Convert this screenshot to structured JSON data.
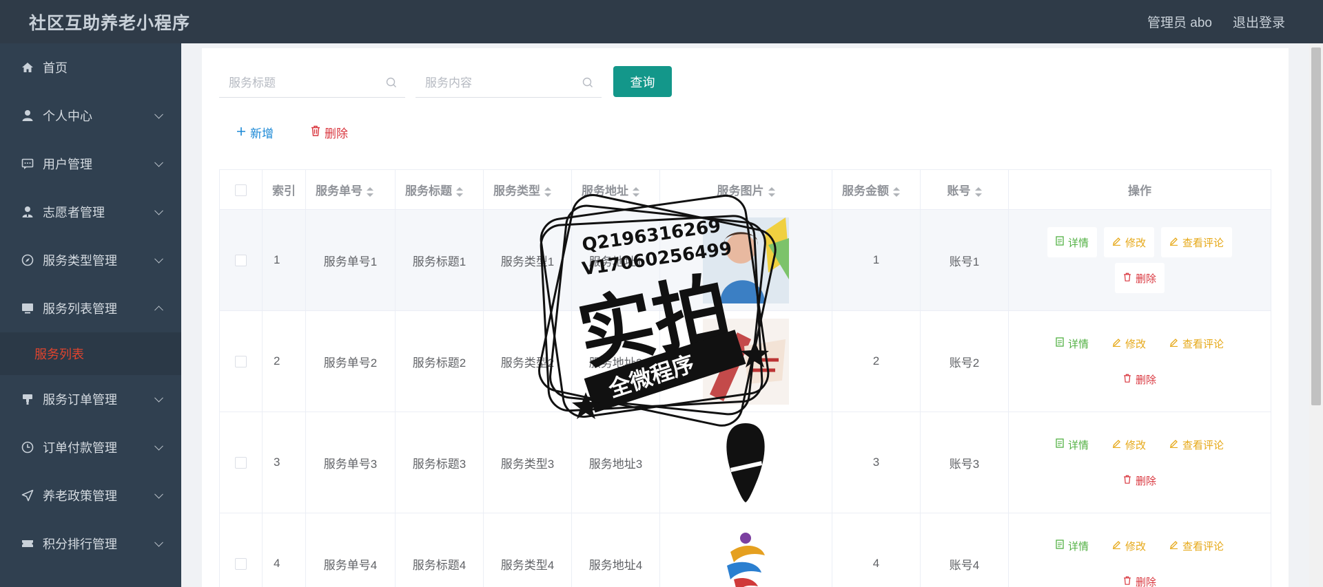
{
  "header": {
    "app_title": "社区互助养老小程序",
    "admin_label": "管理员 abo",
    "logout_label": "退出登录"
  },
  "sidebar": {
    "items": [
      {
        "label": "首页",
        "icon": "home-icon",
        "has_chevron": false
      },
      {
        "label": "个人中心",
        "icon": "user-icon",
        "has_chevron": true
      },
      {
        "label": "用户管理",
        "icon": "chat-icon",
        "has_chevron": true
      },
      {
        "label": "志愿者管理",
        "icon": "volunteer-icon",
        "has_chevron": true
      },
      {
        "label": "服务类型管理",
        "icon": "compass-icon",
        "has_chevron": true
      },
      {
        "label": "服务列表管理",
        "icon": "monitor-icon",
        "has_chevron": true,
        "expanded": true
      },
      {
        "label": "服务订单管理",
        "icon": "stamp-icon",
        "has_chevron": true
      },
      {
        "label": "订单付款管理",
        "icon": "clock-icon",
        "has_chevron": true
      },
      {
        "label": "养老政策管理",
        "icon": "send-icon",
        "has_chevron": true
      },
      {
        "label": "积分排行管理",
        "icon": "ticket-icon",
        "has_chevron": true
      }
    ],
    "active_submenu": "服务列表"
  },
  "search": {
    "title_placeholder": "服务标题",
    "content_placeholder": "服务内容",
    "query_label": "查询"
  },
  "toolbar": {
    "add_label": "新增",
    "delete_label": "删除"
  },
  "table": {
    "columns": [
      "索引",
      "服务单号",
      "服务标题",
      "服务类型",
      "服务地址",
      "服务图片",
      "服务金额",
      "账号",
      "操作"
    ],
    "rows": [
      {
        "index": "1",
        "no": "服务单号1",
        "title": "服务标题1",
        "type": "服务类型1",
        "address": "服务地址1",
        "amount": "1",
        "account": "账号1"
      },
      {
        "index": "2",
        "no": "服务单号2",
        "title": "服务标题2",
        "type": "服务类型2",
        "address": "服务地址2",
        "amount": "2",
        "account": "账号2"
      },
      {
        "index": "3",
        "no": "服务单号3",
        "title": "服务标题3",
        "type": "服务类型3",
        "address": "服务地址3",
        "amount": "3",
        "account": "账号3"
      },
      {
        "index": "4",
        "no": "服务单号4",
        "title": "服务标题4",
        "type": "服务类型4",
        "address": "服务地址4",
        "amount": "4",
        "account": "账号4"
      }
    ],
    "ops": {
      "detail": "详情",
      "edit": "修改",
      "comment": "查看评论",
      "delete": "删除"
    }
  },
  "watermark": {
    "line1": "Q2196316269",
    "line2": "V17060256499",
    "big": "实拍",
    "banner": "全微程序"
  },
  "colors": {
    "header_bg": "#2f3b48",
    "sidebar_bg": "#304050",
    "accent_teal": "#13978a",
    "active_red": "#e0442e",
    "link_blue": "#1a88d6",
    "danger": "#d9363e",
    "success": "#52b043",
    "warning": "#e6a817"
  }
}
